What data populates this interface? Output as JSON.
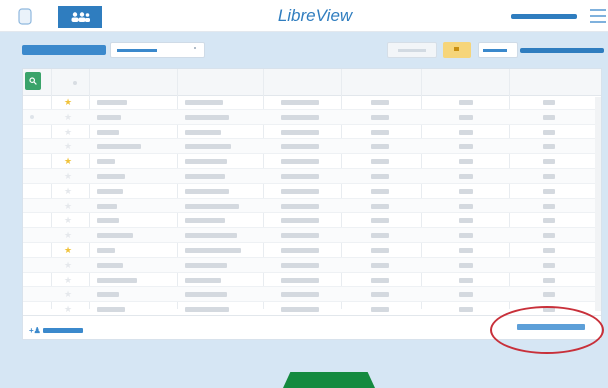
{
  "app": {
    "title": "LibreView"
  },
  "nav": {
    "tabs": [
      {
        "icon": "device-icon"
      },
      {
        "icon": "people-icon",
        "active": true
      }
    ],
    "menu_icon": "hamburger-icon"
  },
  "colors": {
    "accent": "#2f7dbf",
    "background": "#d6e6f4",
    "star_gold": "#f0c23a",
    "search_green": "#3aa36a",
    "bottom_button": "#148a3f",
    "highlight_circle": "#c8303a"
  },
  "table": {
    "search_icon": "search-icon",
    "row_count": 15,
    "favorite_rows": [
      0,
      4,
      10
    ]
  }
}
